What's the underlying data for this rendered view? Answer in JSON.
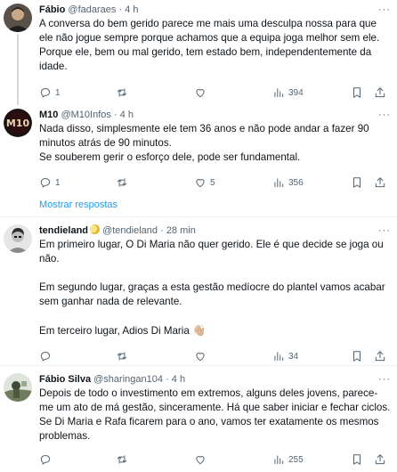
{
  "colors": {
    "accent": "#1d9bf0",
    "text": "#0f1419",
    "muted": "#536471",
    "divider": "#eff3f4"
  },
  "tweets": [
    {
      "name": "Fábio",
      "handle": "@fadaraes",
      "sep": "·",
      "time": "4 h",
      "paragraphs": [
        "A conversa do bem gerido parece me mais uma desculpa nossa para que ele não jogue sempre porque achamos que a equipa joga melhor sem ele. Porque ele, bem ou mal gerido, tem estado bem, independentemente da idade."
      ],
      "replies": "1",
      "retweets": "",
      "likes": "",
      "views": "394"
    },
    {
      "name": "M10",
      "handle": "@M10Infos",
      "sep": "·",
      "time": "4 h",
      "paragraphs": [
        "Nada disso, simplesmente ele tem 36 anos e não pode andar a fazer 90 minutos atrás de 90 minutos.",
        "Se souberem gerir o esforço dele, pode ser fundamental."
      ],
      "replies": "1",
      "retweets": "",
      "likes": "5",
      "views": "356"
    },
    {
      "name": "tendieland",
      "handle": "@tendieland",
      "sep": "·",
      "time": "28 min",
      "paragraphs": [
        "Em primeiro lugar, O Di Maria não quer gerido. Ele é que decide se joga ou não.",
        "Em segundo lugar, graças a esta gestão medíocre do plantel vamos acabar sem ganhar nada de relevante.",
        "Em terceiro lugar, Adios Di Maria"
      ],
      "wave_emoji": "👋🏼",
      "replies": "",
      "retweets": "",
      "likes": "",
      "views": "34"
    },
    {
      "name": "Fábio Silva",
      "handle": "@sharingan104",
      "sep": "·",
      "time": "4 h",
      "paragraphs": [
        "Depois de todo o investimento em extremos, alguns deles jovens, parece-me um ato de má gestão, sinceramente. Há que saber iniciar e fechar ciclos. Se Di Maria e Rafa ficarem para o ano, vamos ter exatamente os mesmos problemas."
      ],
      "replies": "",
      "retweets": "",
      "likes": "",
      "views": "255"
    }
  ],
  "show_more": "Mostrar respostas"
}
